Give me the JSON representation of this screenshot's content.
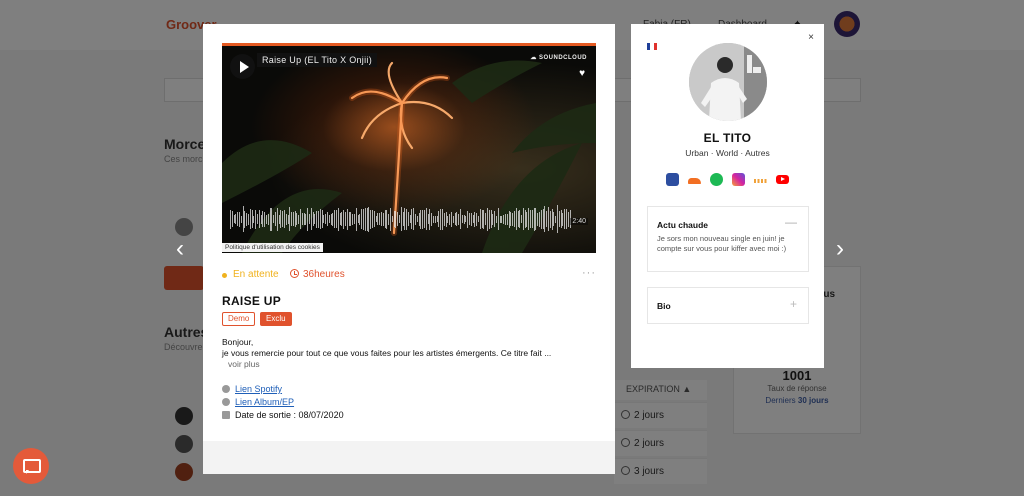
{
  "background": {
    "logo_text": "Groover",
    "nav_item_1": "Fabia (FR)",
    "nav_item_2": "Dashboard",
    "section_1_title": "Morce",
    "section_1_subtitle": "Ces morc",
    "section_2_title": "Autres",
    "section_2_subtitle": "Découvre",
    "expiration_header": "EXPIRATION ▲",
    "expirations": [
      "2 jours",
      "2 jours",
      "3 jours"
    ],
    "stats": {
      "status_label": "tus",
      "response_count": "1001",
      "response_rate_label": "Taux de réponse",
      "last_label_prefix": "Derniers",
      "last_label_days": "30 jours"
    }
  },
  "player": {
    "track_title": "Raise Up (EL Tito X Onjii)",
    "brand": "SOUNDCLOUD",
    "duration": "2:40",
    "cookie_policy": "Politique d'utilisation des cookies"
  },
  "submission": {
    "status": "En attente",
    "time_left": "36heures",
    "title": "RAISE UP",
    "tags": [
      "Demo",
      "Exclu"
    ],
    "message_greeting": "Bonjour,",
    "message_body": "je vous remercie pour tout ce que vous faites pour les artistes émergents. Ce titre  fait ...",
    "see_more": "voir plus",
    "link_spotify": "Lien Spotify",
    "link_album": "Lien Album/EP",
    "release_date": "Date de sortie : 08/07/2020"
  },
  "artist": {
    "name": "EL TITO",
    "genres": "Urban · World · Autres",
    "country_flag_colors": [
      "#1f3f99",
      "#ffffff",
      "#e0322d"
    ],
    "socials": [
      "facebook-icon",
      "soundcloud-icon",
      "spotify-icon",
      "instagram-icon",
      "deezer-icon",
      "youtube-icon"
    ],
    "news_title": "Actu chaude",
    "news_text": "Je sors mon nouveau single en juin! je compte sur vous pour kiffer avec moi :)",
    "bio_title": "Bio",
    "close_glyph": "×"
  },
  "colors": {
    "accent": "#e0522d",
    "pending": "#f0b21e",
    "link": "#1f5fb8"
  }
}
